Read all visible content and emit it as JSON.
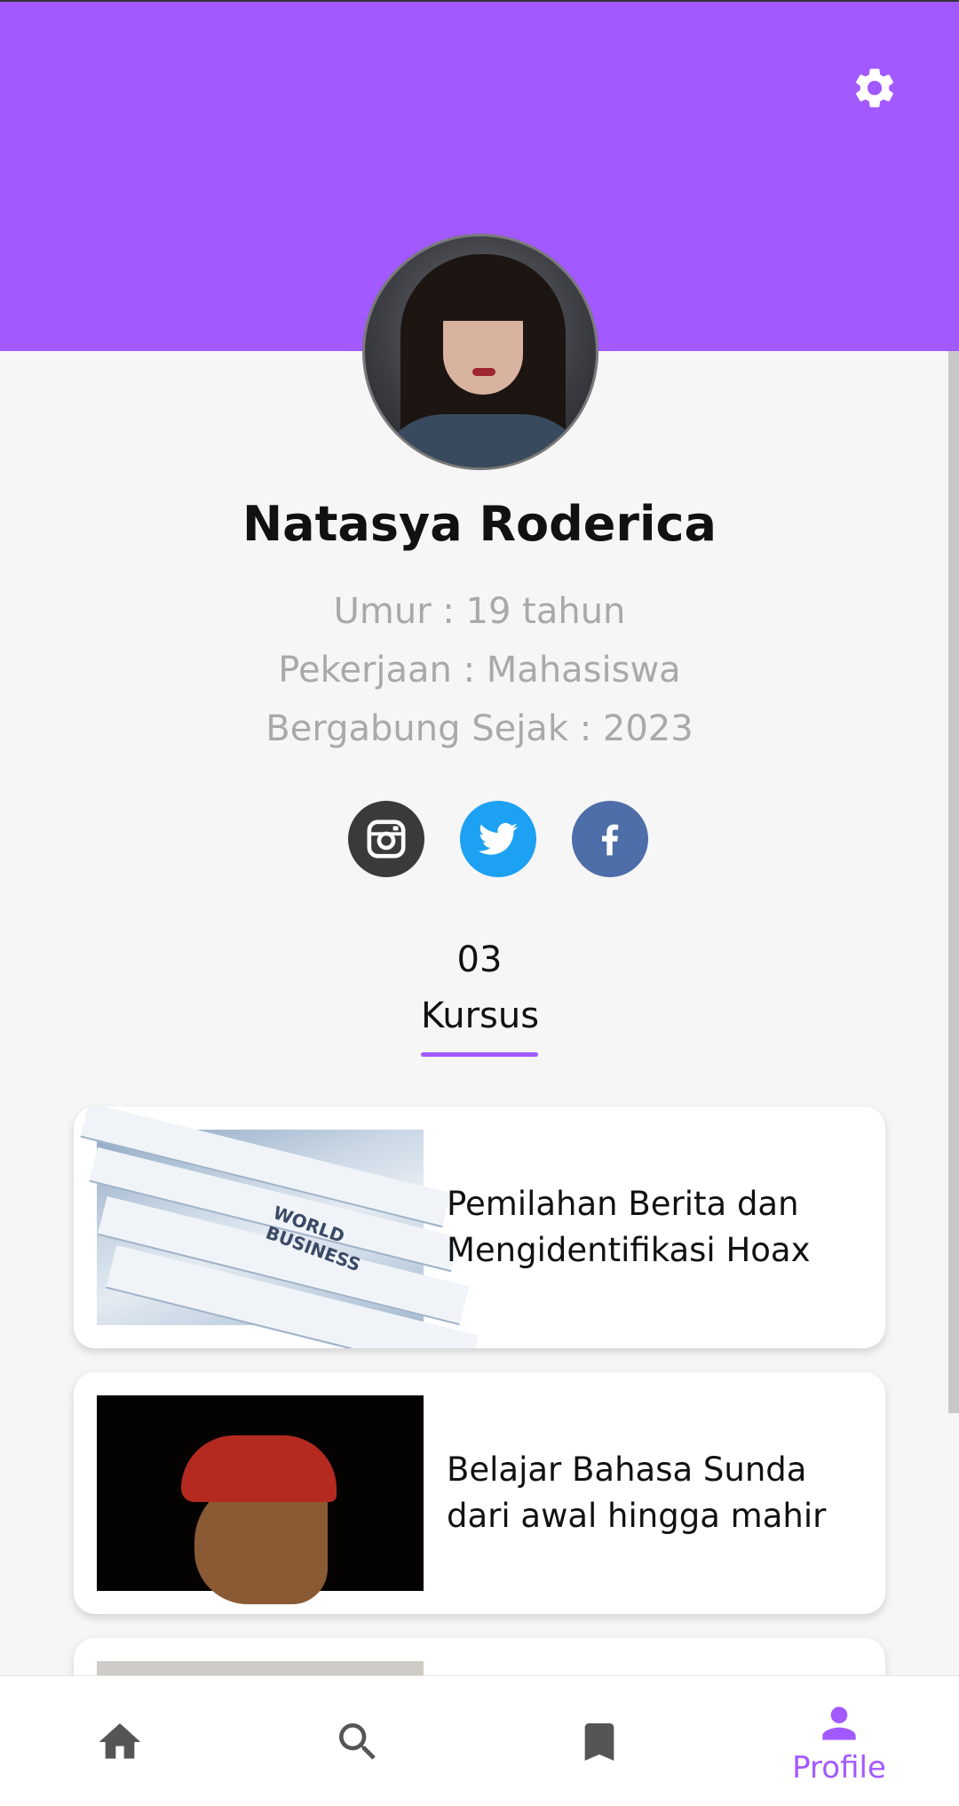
{
  "profile": {
    "name": "Natasya Roderica",
    "age": "Umur : 19 tahun",
    "job": "Pekerjaan : Mahasiswa",
    "joined": "Bergabung Sejak : 2023"
  },
  "stats": {
    "course_count": "03",
    "tab_label": "Kursus"
  },
  "courses": [
    {
      "title": "Pemilahan Berita dan Mengidentifikasi Hoax",
      "thumb_text": "WORLD BUSINESS"
    },
    {
      "title": "Belajar Bahasa Sunda dari awal hingga mahir"
    },
    {
      "title": ""
    }
  ],
  "bottom_nav": {
    "items": [
      {
        "icon": "home-icon",
        "label": ""
      },
      {
        "icon": "search-icon",
        "label": ""
      },
      {
        "icon": "bookmark-icon",
        "label": ""
      },
      {
        "icon": "profile-icon",
        "label": "Profile"
      }
    ],
    "active_index": 3
  },
  "colors": {
    "accent": "#a259ff",
    "instagram": "#3a3a3a",
    "twitter": "#1da1f2",
    "facebook": "#4e6ea9",
    "muted_text": "#a9a9a9",
    "inactive_icon": "#555555"
  }
}
